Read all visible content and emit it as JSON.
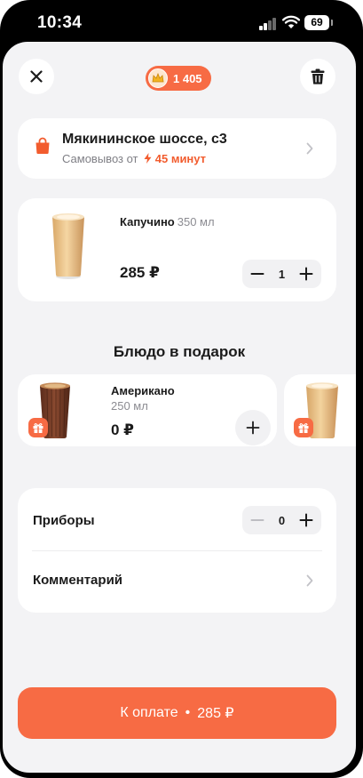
{
  "status_bar": {
    "time": "10:34",
    "battery": "69"
  },
  "header": {
    "points": "1 405"
  },
  "pickup": {
    "title": "Мякининское шоссе, с3",
    "subtitle_prefix": "Самовывоз от",
    "time": "45 минут"
  },
  "cart_item": {
    "name": "Капучино",
    "volume": "350 мл",
    "price": "285 ₽",
    "quantity": "1"
  },
  "gift_section": {
    "title": "Блюдо в подарок",
    "items": [
      {
        "name": "Американо",
        "volume": "250 мл",
        "price": "0 ₽"
      }
    ]
  },
  "options": {
    "cutlery_label": "Приборы",
    "cutlery_count": "0",
    "comment_label": "Комментарий"
  },
  "checkout": {
    "label": "К оплате",
    "separator": "•",
    "total": "285 ₽"
  },
  "colors": {
    "accent": "#f76b44",
    "background": "#f3f3f5",
    "card": "#ffffff"
  }
}
